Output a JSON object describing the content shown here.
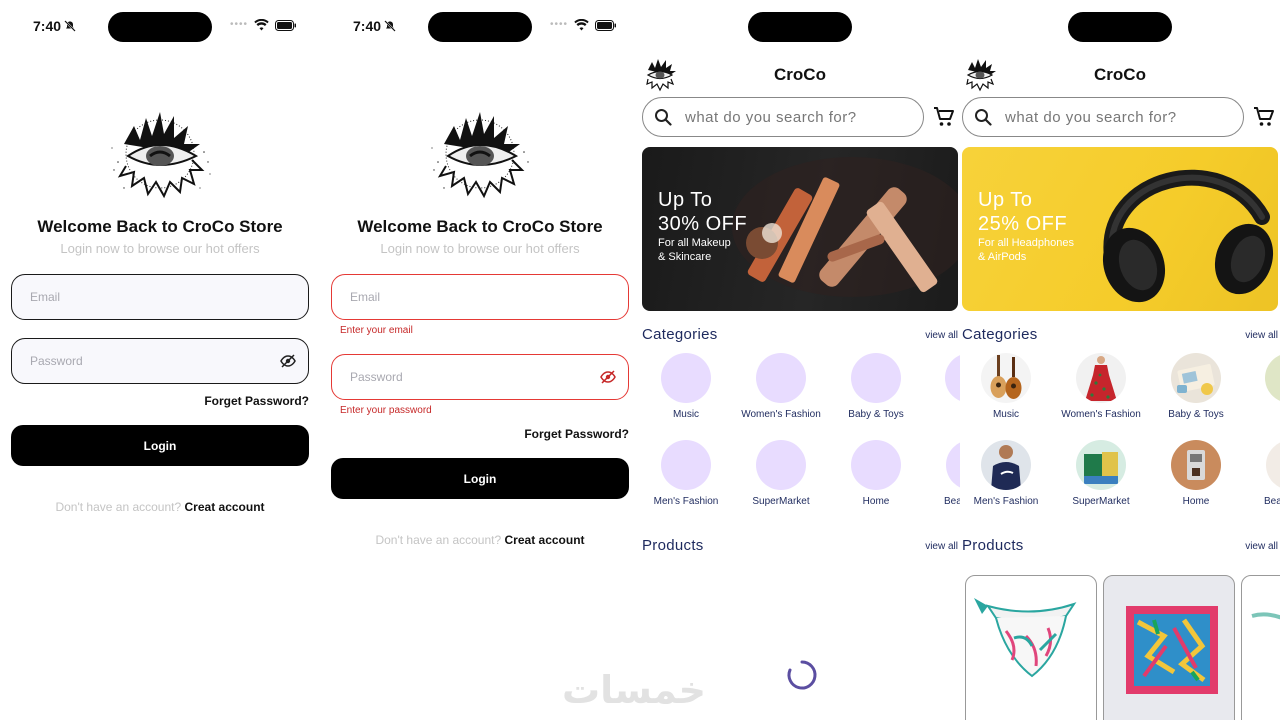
{
  "status_bar": {
    "time": "7:40"
  },
  "login": {
    "welcome": "Welcome Back to CroCo Store",
    "subtitle": "Login now to browse our hot offers",
    "email_placeholder": "Email",
    "password_placeholder": "Password",
    "email_error": "Enter your email",
    "password_error": "Enter your password",
    "forget_password": "Forget Password?",
    "login_button": "Login",
    "no_account": "Don't have an account?",
    "create_account": "Creat account"
  },
  "home": {
    "title": "CroCo",
    "search_placeholder": "what do you search for?",
    "banners": [
      {
        "line1": "Up To",
        "line2": "30% OFF",
        "sub1": "For all Makeup",
        "sub2": "& Skincare"
      },
      {
        "line1": "Up To",
        "line2": "25% OFF",
        "sub1": "For all Headphones",
        "sub2": "& AirPods"
      }
    ],
    "categories_title": "Categories",
    "products_title": "Products",
    "view_all": "view all",
    "categories": [
      "Music",
      "Women's Fashion",
      "Baby & Toys",
      "Men's Fashion",
      "SuperMarket",
      "Home",
      "Beau"
    ]
  },
  "watermark": "خمسات",
  "colors": {
    "accent_navy": "#1e2a5e",
    "error": "#e53935",
    "placeholder_circle": "#e8dcff",
    "banner_yellow": "#f7d23a"
  }
}
